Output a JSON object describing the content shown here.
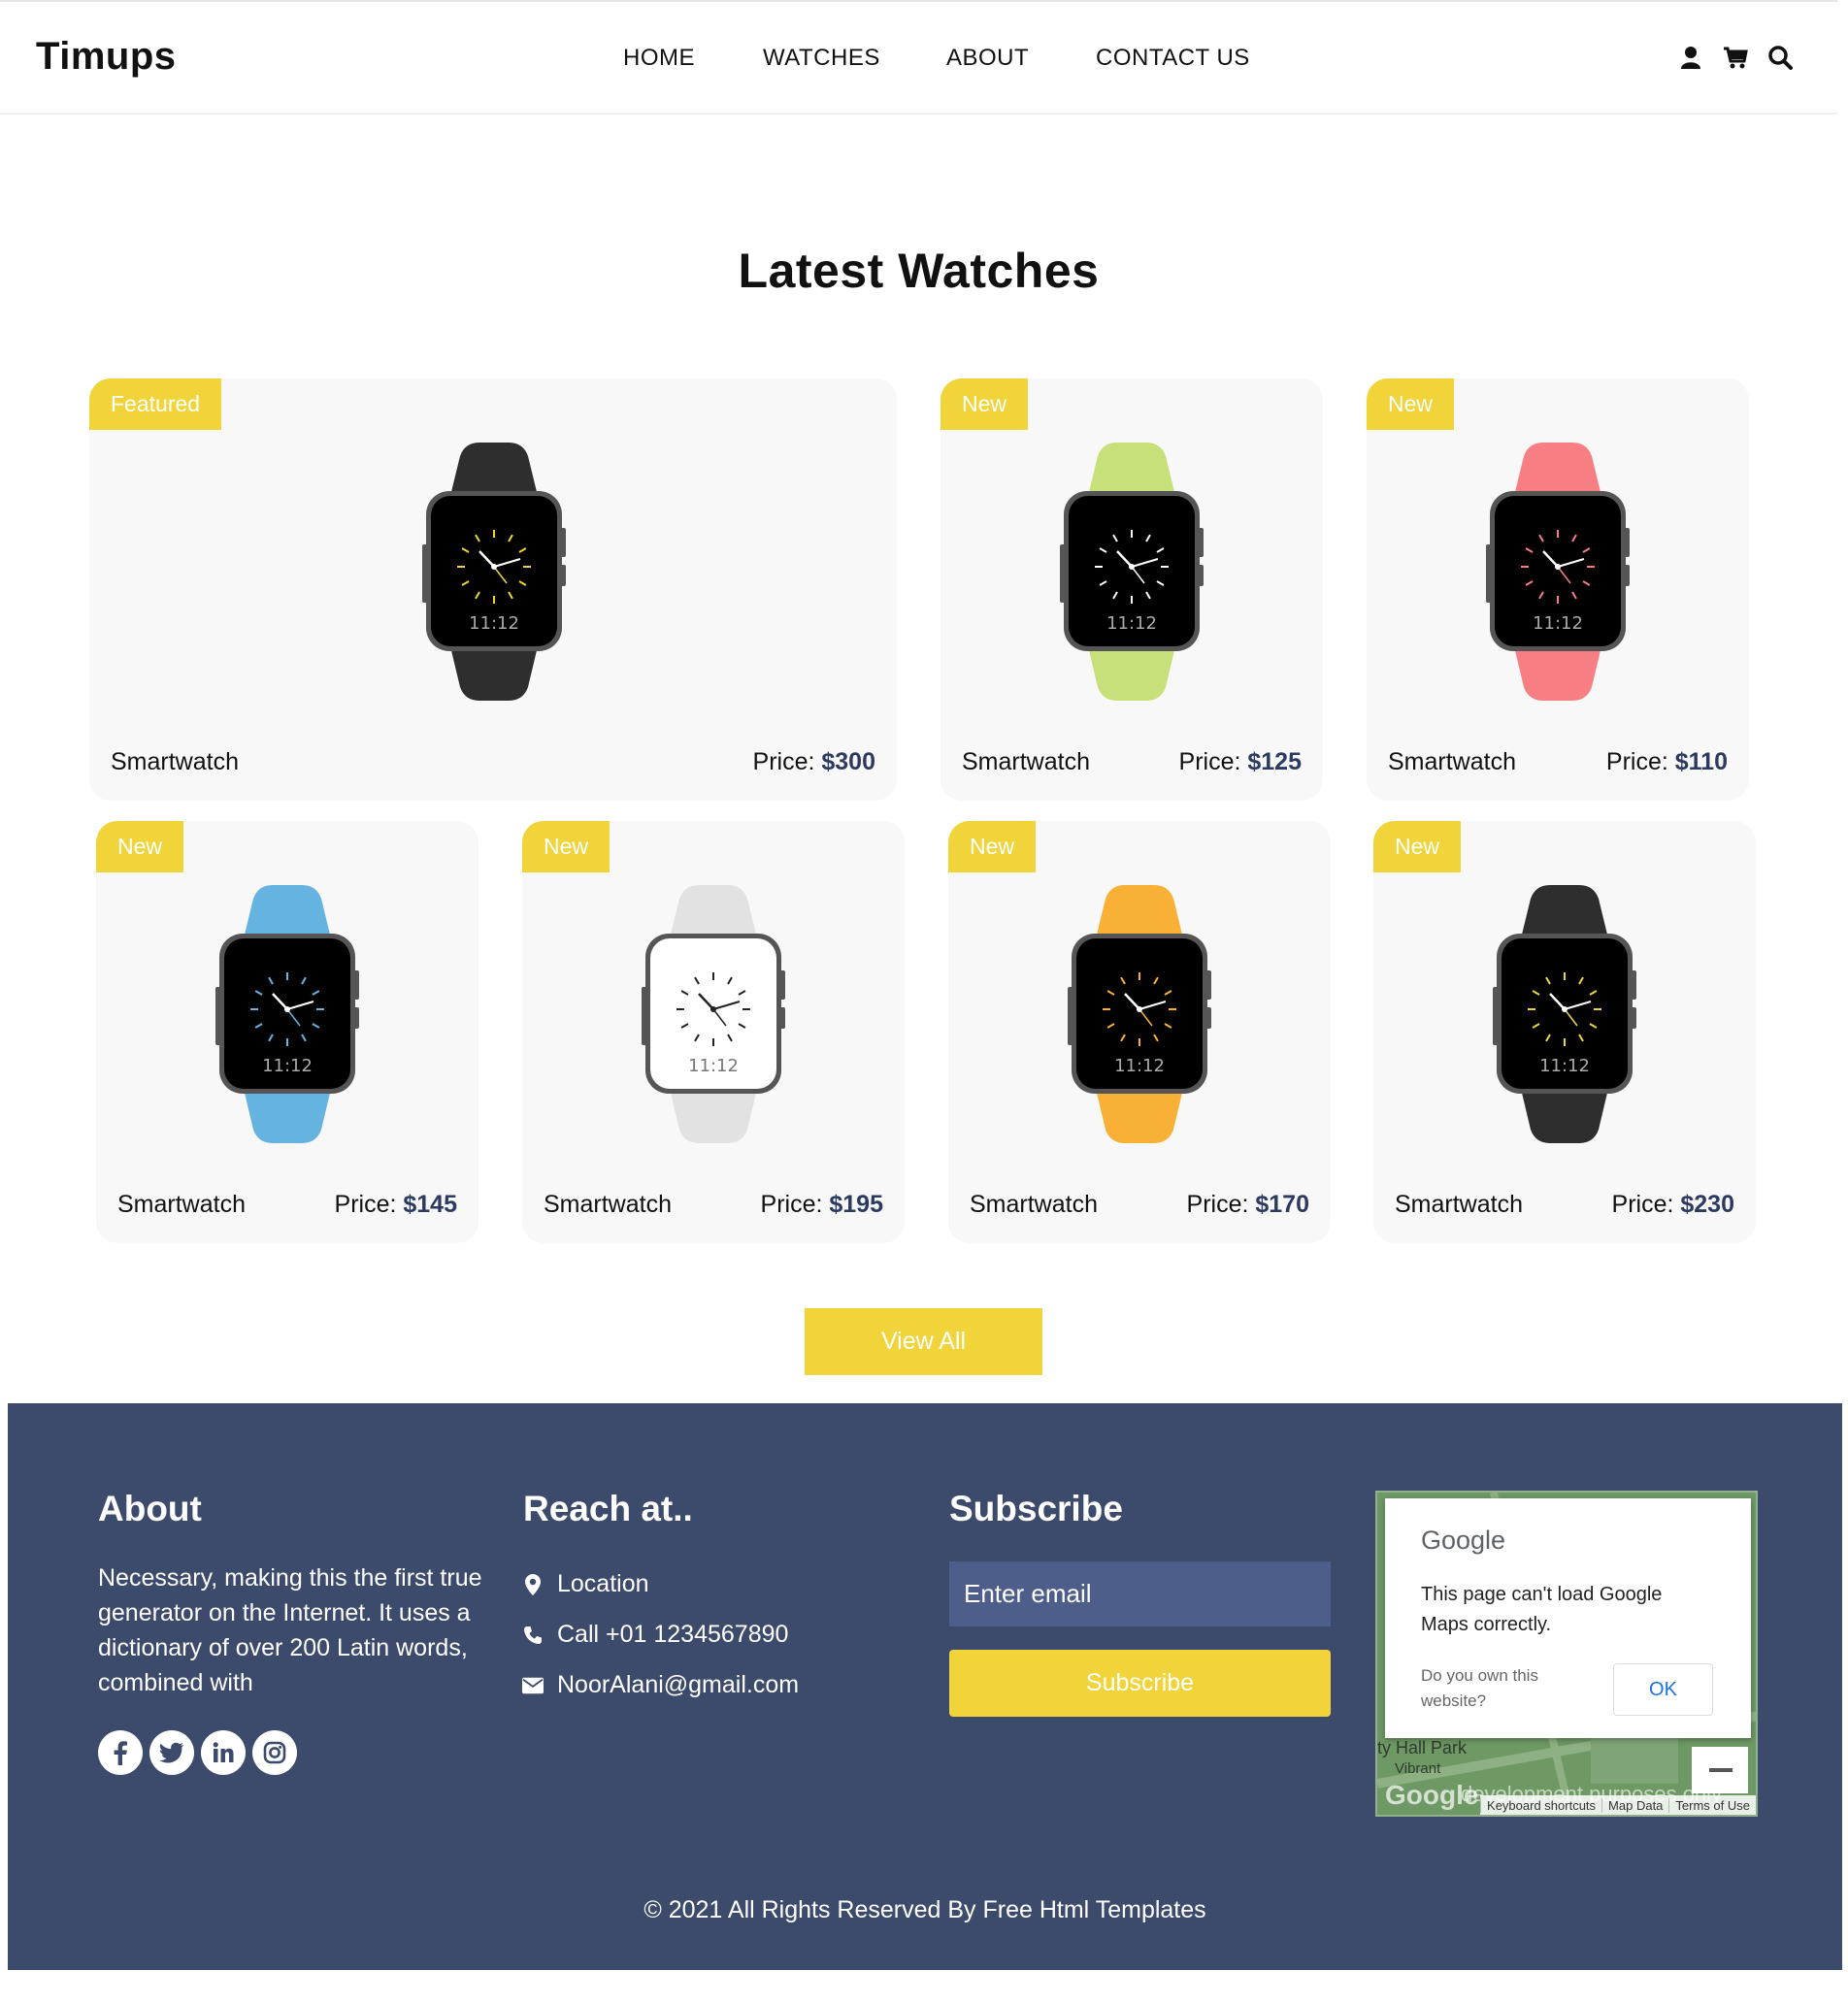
{
  "header": {
    "brand": "Timups",
    "nav": [
      "HOME",
      "WATCHES",
      "ABOUT",
      "CONTACT US"
    ],
    "icons": [
      "user-icon",
      "cart-icon",
      "search-icon"
    ]
  },
  "main": {
    "title": "Latest Watches",
    "cards": [
      {
        "badge": "Featured",
        "name": "Smartwatch",
        "price_label": "Price:",
        "price": "$300",
        "strap": "#2e2e2e",
        "face": "#000000",
        "ticks": "#f0d43a"
      },
      {
        "badge": "New",
        "name": "Smartwatch",
        "price_label": "Price:",
        "price": "$125",
        "strap": "#c7e07a",
        "face": "#000000",
        "ticks": "#ffffff"
      },
      {
        "badge": "New",
        "name": "Smartwatch",
        "price_label": "Price:",
        "price": "$110",
        "strap": "#f77f83",
        "face": "#000000",
        "ticks": "#f77f83"
      },
      {
        "badge": "New",
        "name": "Smartwatch",
        "price_label": "Price:",
        "price": "$145",
        "strap": "#64b3e0",
        "face": "#000000",
        "ticks": "#64b3e0"
      },
      {
        "badge": "New",
        "name": "Smartwatch",
        "price_label": "Price:",
        "price": "$195",
        "strap": "#e2e2e2",
        "face": "#ffffff",
        "ticks": "#222222"
      },
      {
        "badge": "New",
        "name": "Smartwatch",
        "price_label": "Price:",
        "price": "$170",
        "strap": "#f9b036",
        "face": "#000000",
        "ticks": "#f9b036"
      },
      {
        "badge": "New",
        "name": "Smartwatch",
        "price_label": "Price:",
        "price": "$230",
        "strap": "#2e2e2e",
        "face": "#000000",
        "ticks": "#f0d43a"
      }
    ],
    "watch_time": "11:12",
    "view_all": "View All"
  },
  "footer": {
    "about_title": "About",
    "about_text": "Necessary, making this the first true generator on the Internet. It uses a dictionary of over 200 Latin words, combined with",
    "socials": [
      "facebook-icon",
      "twitter-icon",
      "linkedin-icon",
      "instagram-icon"
    ],
    "reach_title": "Reach at..",
    "location": "Location",
    "call": "Call +01 1234567890",
    "email": "NoorAlani@gmail.com",
    "subscribe_title": "Subscribe",
    "email_placeholder": "Enter email",
    "subscribe_button": "Subscribe",
    "map": {
      "logo": "Google",
      "message": "This page can't load Google Maps correctly.",
      "question": "Do you own this website?",
      "ok": "OK",
      "labels": [
        "ty Hall Park",
        "Vibrant"
      ],
      "watermark": "development purposes only",
      "attribution": [
        "Keyboard shortcuts",
        "Map Data",
        "Terms of Use"
      ]
    },
    "copyright": "© 2021 All Rights Reserved By Free Html Templates",
    "colors": {
      "background": "#3c4a6b",
      "accent": "#f0d43a",
      "input": "#4e5e8a"
    }
  }
}
